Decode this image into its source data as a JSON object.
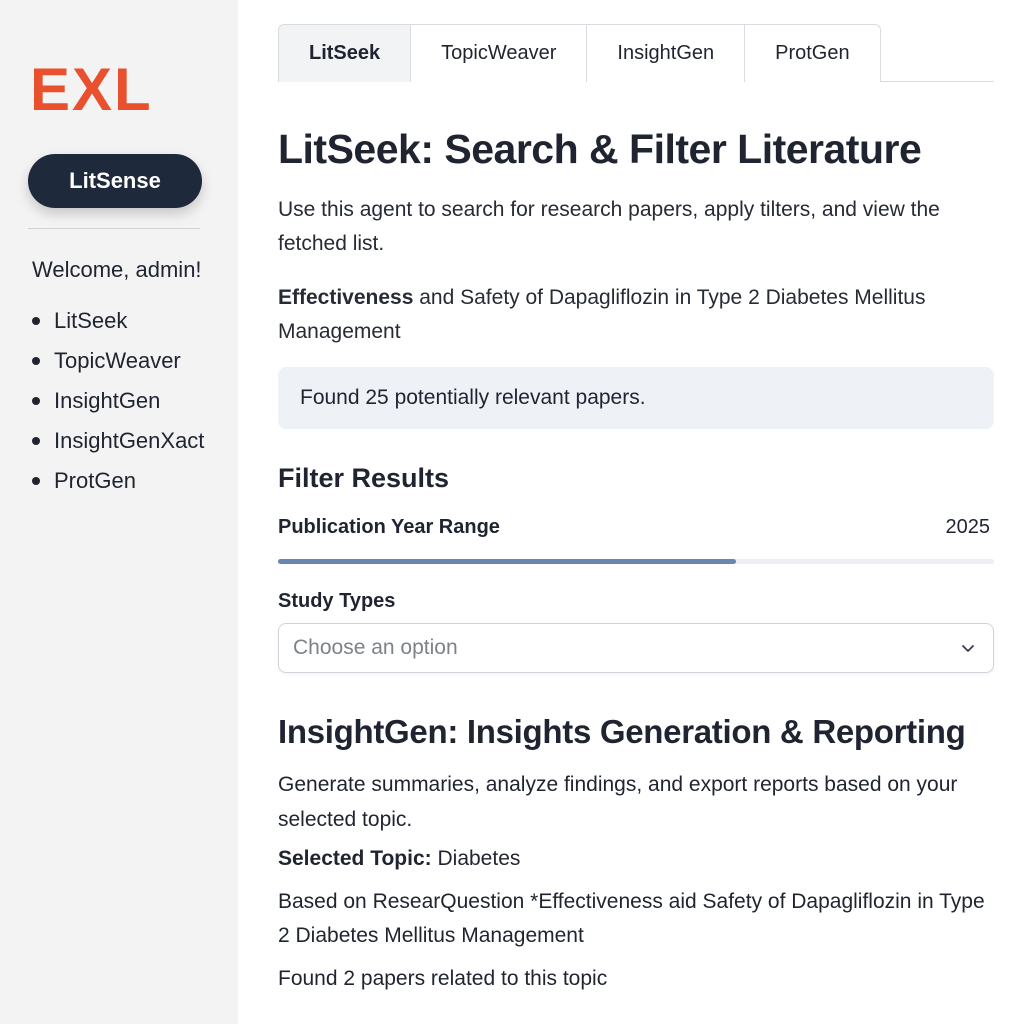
{
  "sidebar": {
    "logo": "EXL",
    "app_button": "LitSense",
    "welcome": "Welcome, admin!",
    "nav": [
      "LitSeek",
      "TopicWeaver",
      "InsightGen",
      "InsightGenXact",
      "ProtGen"
    ]
  },
  "tabs": [
    "LitSeek",
    "TopicWeaver",
    "InsightGen",
    "ProtGen"
  ],
  "active_tab": "LitSeek",
  "litseek": {
    "title": "LitSeek: Search & Filter Literature",
    "description": "Use this agent to search for research papers, apply tilters, and view the fetched list.",
    "question_bold": "Effectiveness",
    "question_rest": " and Safety of Dapagliflozin in Type 2 Diabetes Mellitus Management",
    "found": "Found 25 potentially relevant papers.",
    "filter_heading": "Filter Results",
    "year_label": "Publication Year Range",
    "year_value": "2025",
    "year_slider_fraction": 0.64,
    "study_types_label": "Study Types",
    "study_types_placeholder": "Choose an option"
  },
  "insightgen": {
    "title": "InsightGen: Insights Generation & Reporting",
    "description": "Generate summaries, analyze findings, and export reports based on your selected topic.",
    "topic_label": "Selected Topic:",
    "topic_value": " Diabetes",
    "based_on": "Based on ResearQuestion *Effectiveness aid Safety of Dapagliflozin in Type 2 Diabetes Mellitus Management",
    "found": "Found 2 papers related to this topic"
  },
  "colors": {
    "brand": "#e9502e",
    "button_dark": "#1e2a3c",
    "slider_fill": "#6b86ad",
    "info_box": "#eef2f7"
  },
  "icons": {
    "select_chevron": "chevron-down-icon"
  }
}
